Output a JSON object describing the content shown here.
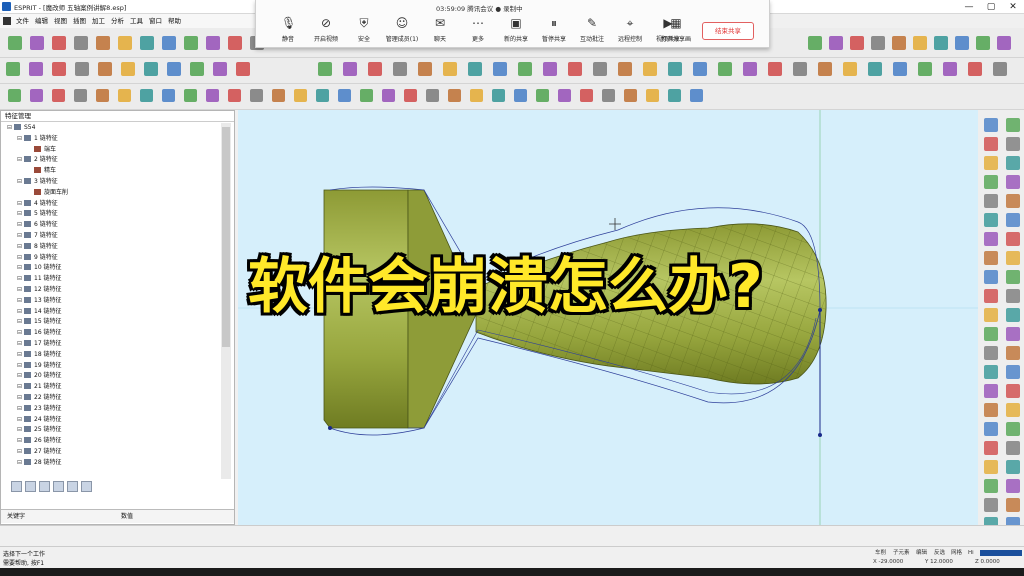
{
  "window": {
    "title": "ESPRIT - [魔改师 五轴案例讲解8.esp]",
    "controls": [
      "—",
      "▢",
      "✕"
    ]
  },
  "menu": [
    "文件",
    "编辑",
    "视图",
    "插图",
    "加工",
    "分析",
    "工具",
    "窗口",
    "帮助"
  ],
  "meeting": {
    "status": "03:59:09  腾讯会议  ● 录制中",
    "tools": [
      {
        "label": "静音",
        "icon": "microphone-icon"
      },
      {
        "label": "开启视频",
        "icon": "camera-off-icon"
      },
      {
        "label": "安全",
        "icon": "shield-icon"
      },
      {
        "label": "管理成员(1)",
        "icon": "people-icon"
      },
      {
        "label": "聊天",
        "icon": "chat-icon"
      },
      {
        "label": "更多",
        "icon": "more-icon"
      },
      {
        "label": "新的共享",
        "icon": "share-screen-icon"
      },
      {
        "label": "暂停共享",
        "icon": "pause-share-icon"
      },
      {
        "label": "互动批注",
        "icon": "annotate-icon"
      },
      {
        "label": "远程控制",
        "icon": "remote-control-icon"
      },
      {
        "label": "视频共享",
        "icon": "video-share-icon"
      },
      {
        "label": "打开共享画",
        "icon": "screen-share-icon"
      }
    ],
    "end_share": "结束共享"
  },
  "panel": {
    "title": "特征管理",
    "tree": [
      {
        "label": "S54",
        "indent": 0,
        "kind": "root"
      },
      {
        "label": "1 链特征",
        "indent": 1,
        "kind": "feature"
      },
      {
        "label": "端车",
        "indent": 2,
        "kind": "op"
      },
      {
        "label": "2 链特征",
        "indent": 1,
        "kind": "feature"
      },
      {
        "label": "精车",
        "indent": 2,
        "kind": "op"
      },
      {
        "label": "3 链特征",
        "indent": 1,
        "kind": "feature"
      },
      {
        "label": "旋面车削",
        "indent": 2,
        "kind": "op"
      },
      {
        "label": "4 链特征",
        "indent": 1,
        "kind": "feature"
      },
      {
        "label": "5 链特征",
        "indent": 1,
        "kind": "feature"
      },
      {
        "label": "6 链特征",
        "indent": 1,
        "kind": "feature"
      },
      {
        "label": "7 链特征",
        "indent": 1,
        "kind": "feature"
      },
      {
        "label": "8 链特征",
        "indent": 1,
        "kind": "feature"
      },
      {
        "label": "9 链特征",
        "indent": 1,
        "kind": "feature"
      },
      {
        "label": "10 链特征",
        "indent": 1,
        "kind": "feature"
      },
      {
        "label": "11 链特征",
        "indent": 1,
        "kind": "feature"
      },
      {
        "label": "12 链特征",
        "indent": 1,
        "kind": "feature"
      },
      {
        "label": "13 链特征",
        "indent": 1,
        "kind": "feature"
      },
      {
        "label": "14 链特征",
        "indent": 1,
        "kind": "feature"
      },
      {
        "label": "15 链特征",
        "indent": 1,
        "kind": "feature"
      },
      {
        "label": "16 链特征",
        "indent": 1,
        "kind": "feature"
      },
      {
        "label": "17 链特征",
        "indent": 1,
        "kind": "feature"
      },
      {
        "label": "18 链特征",
        "indent": 1,
        "kind": "feature"
      },
      {
        "label": "19 链特征",
        "indent": 1,
        "kind": "feature"
      },
      {
        "label": "20 链特征",
        "indent": 1,
        "kind": "feature"
      },
      {
        "label": "21 链特征",
        "indent": 1,
        "kind": "feature"
      },
      {
        "label": "22 链特征",
        "indent": 1,
        "kind": "feature"
      },
      {
        "label": "23 链特征",
        "indent": 1,
        "kind": "feature"
      },
      {
        "label": "24 链特征",
        "indent": 1,
        "kind": "feature"
      },
      {
        "label": "25 链特征",
        "indent": 1,
        "kind": "feature"
      },
      {
        "label": "26 链特征",
        "indent": 1,
        "kind": "feature"
      },
      {
        "label": "27 链特征",
        "indent": 1,
        "kind": "feature"
      },
      {
        "label": "28 链特征",
        "indent": 1,
        "kind": "feature"
      }
    ],
    "prop_key": "关键字",
    "prop_value": "数值"
  },
  "overlay": {
    "caption": "软件会崩溃怎么办?"
  },
  "status": {
    "line1": "选择下一个工作",
    "line2": "需要帮助, 按F1",
    "buttons": [
      "车削",
      "子元素",
      "编辑",
      "反选",
      "网格",
      "Hi"
    ],
    "coords": [
      "X -29.0000",
      "Y 12.0000",
      "Z 0.0000"
    ]
  },
  "colors": {
    "viewport_bg": "#d6effb",
    "part_green": "#a8b84a",
    "caption_yellow": "#ffe829"
  }
}
